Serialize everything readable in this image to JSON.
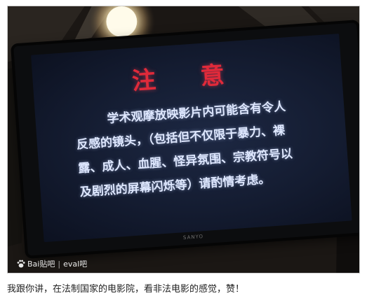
{
  "photo": {
    "screen_title": "注 意",
    "screen_text": "学术观摩放映影片内可能含有令人反感的镜头，（包括但不仅限于暴力、裸露、成人、血腥、怪异氛围、宗教符号以及剧烈的屏幕闪烁等）请酌情考虑。",
    "tv_brand": "SANYO",
    "watermark_logo": "Bai贴吧",
    "watermark_user": "eval吧",
    "colors": {
      "title": "#e02a3a",
      "text": "#dfe8ff",
      "screen": "#141c31"
    }
  },
  "caption": "我跟你讲，在法制国家的电影院，看非法电影的感觉，赞！"
}
